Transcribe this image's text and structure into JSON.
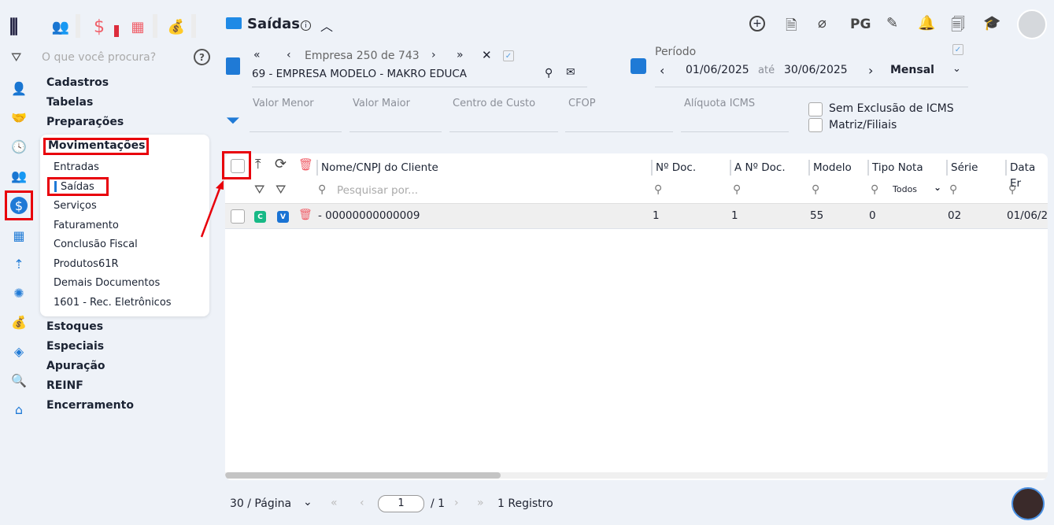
{
  "header": {
    "title": "Saídas",
    "info_icon": "info-icon"
  },
  "search": {
    "placeholder": "O que você procura?"
  },
  "menu": {
    "items": [
      "Cadastros",
      "Tabelas",
      "Preparações",
      "Movimentações",
      "Estoques",
      "Especiais",
      "Apuração",
      "REINF",
      "Encerramento"
    ],
    "submenu": [
      "Entradas",
      "Saídas",
      "Serviços",
      "Faturamento",
      "Conclusão Fiscal",
      "Produtos61R",
      "Demais Documentos",
      "1601 - Rec. Eletrônicos"
    ]
  },
  "company": {
    "label": "Empresa",
    "current": "250",
    "of": "de",
    "total": "743",
    "name": "69 - EMPRESA MODELO - MAKRO EDUCA"
  },
  "period": {
    "label": "Período",
    "start": "01/06/2025",
    "until": "até",
    "end": "30/06/2025",
    "mode": "Mensal"
  },
  "filters": {
    "valor_menor": "Valor Menor",
    "valor_maior": "Valor Maior",
    "centro": "Centro de Custo",
    "cfop": "CFOP",
    "aliquota": "Alíquota ICMS",
    "sem_exclusao": "Sem Exclusão de ICMS",
    "matriz": "Matriz/Filiais"
  },
  "toolbar": {
    "pg": "PG"
  },
  "table": {
    "columns": [
      "Nome/CNPJ do Cliente",
      "Nº Doc.",
      "A Nº Doc.",
      "Modelo",
      "Tipo Nota",
      "Série",
      "Data Er"
    ],
    "search_placeholder": "Pesquisar por...",
    "tipo_filter": "Todos",
    "rows": [
      {
        "c": "C",
        "v": "V",
        "nome": "- 00000000000009",
        "ndoc": "1",
        "andoc": "1",
        "modelo": "55",
        "tipo": "0",
        "serie": "02",
        "data": "01/06/2"
      }
    ]
  },
  "pagination": {
    "per_page": "30 / Página",
    "page": "1",
    "total_pages": "/ 1",
    "records": "1 Registro"
  }
}
